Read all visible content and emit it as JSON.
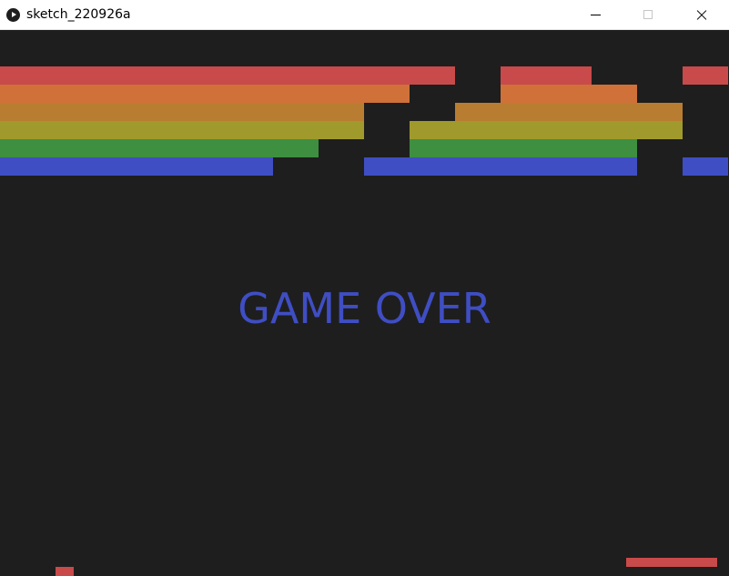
{
  "window": {
    "title": "sketch_220926a",
    "icon": "processing-play-icon",
    "controls": [
      "minimize-icon",
      "maximize-icon",
      "close-icon"
    ]
  },
  "game": {
    "status_text": "GAME OVER",
    "status_color": "#3f4ec3",
    "background_color": "#1e1e1e",
    "paddle_color": "#c94a4a",
    "ball_color": "#c94a4a",
    "brick_grid": {
      "columns": 16,
      "rows": [
        {
          "color": "#c94a4a",
          "bricks": [
            1,
            1,
            1,
            1,
            1,
            1,
            1,
            1,
            1,
            1,
            0,
            1,
            1,
            0,
            0,
            1
          ]
        },
        {
          "color": "#cf7138",
          "bricks": [
            1,
            1,
            1,
            1,
            1,
            1,
            1,
            1,
            1,
            0,
            0,
            1,
            1,
            1,
            0,
            0
          ]
        },
        {
          "color": "#b97d32",
          "bricks": [
            1,
            1,
            1,
            1,
            1,
            1,
            1,
            1,
            0,
            0,
            1,
            1,
            1,
            1,
            1,
            0
          ]
        },
        {
          "color": "#a09a2c",
          "bricks": [
            1,
            1,
            1,
            1,
            1,
            1,
            1,
            1,
            0,
            1,
            1,
            1,
            1,
            1,
            1,
            0
          ]
        },
        {
          "color": "#3e8f40",
          "bricks": [
            1,
            1,
            1,
            1,
            1,
            1,
            1,
            0,
            0,
            1,
            1,
            1,
            1,
            1,
            0,
            0
          ]
        },
        {
          "color": "#3f4ec3",
          "bricks": [
            1,
            1,
            1,
            1,
            1,
            1,
            0,
            0,
            1,
            1,
            1,
            1,
            1,
            1,
            0,
            1
          ]
        }
      ]
    }
  }
}
